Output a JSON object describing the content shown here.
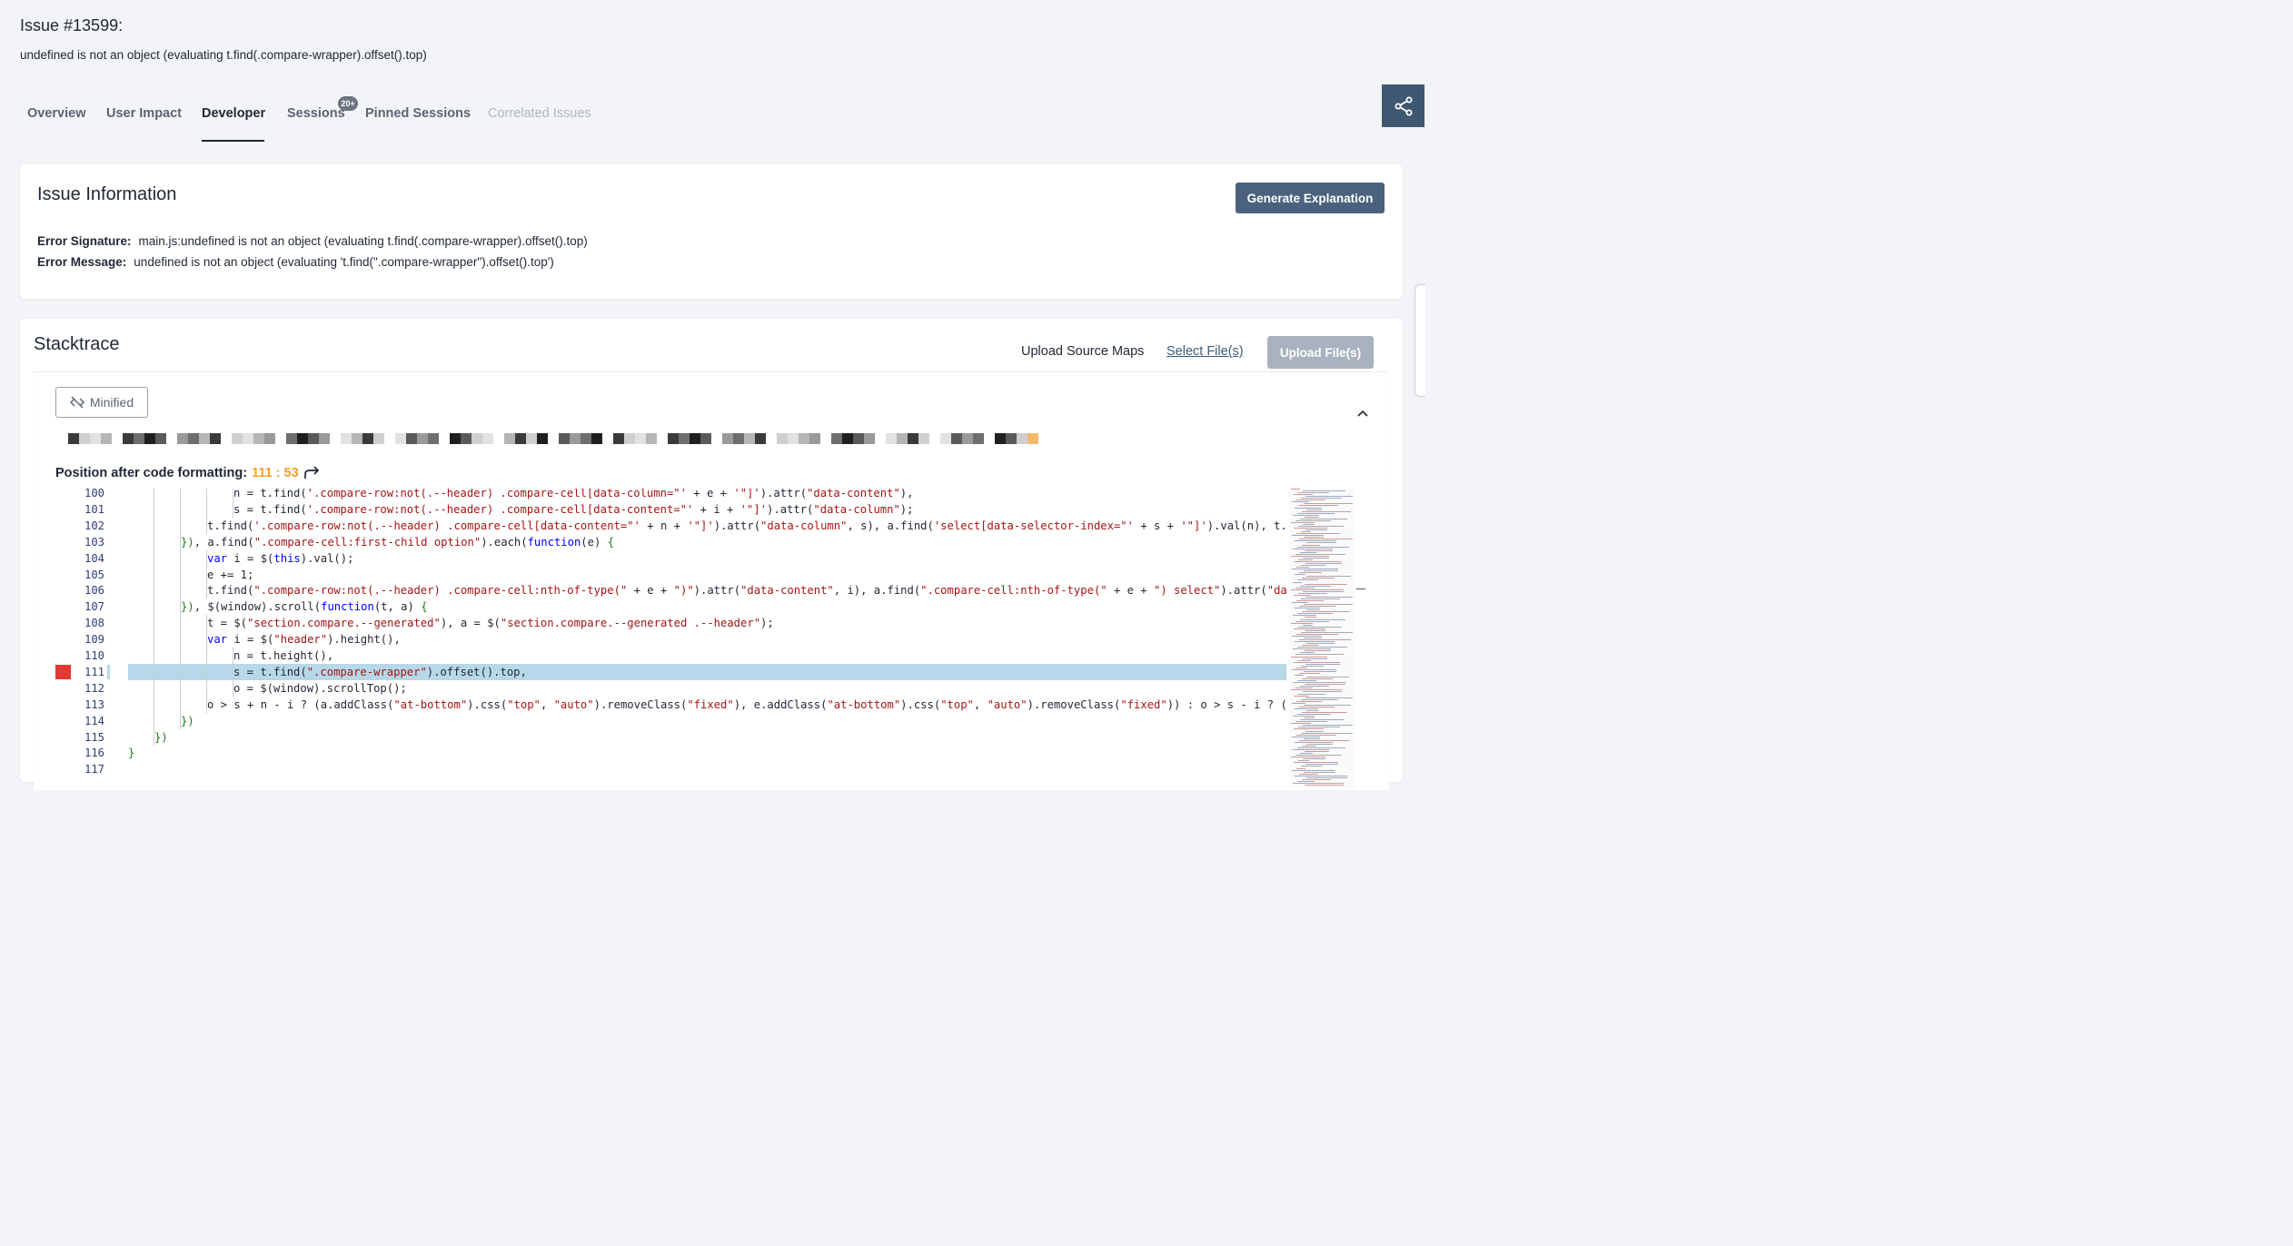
{
  "issue": {
    "title": "Issue #13599:",
    "subtitle": "undefined is not an object (evaluating t.find(.compare-wrapper).offset().top)"
  },
  "tabs": [
    {
      "label": "Overview",
      "state": "normal"
    },
    {
      "label": "User Impact",
      "state": "normal"
    },
    {
      "label": "Developer",
      "state": "active"
    },
    {
      "label": "Sessions",
      "state": "normal",
      "badge": "20+"
    },
    {
      "label": "Pinned Sessions",
      "state": "normal"
    },
    {
      "label": "Correlated Issues",
      "state": "disabled"
    }
  ],
  "issue_info": {
    "title": "Issue Information",
    "generate_label": "Generate Explanation",
    "signature_label": "Error Signature:",
    "signature_value": "main.js:undefined is not an object (evaluating t.find(.compare-wrapper).offset().top)",
    "message_label": "Error Message:",
    "message_value": "undefined is not an object (evaluating 't.find(\".compare-wrapper\").offset().top')"
  },
  "stacktrace": {
    "title": "Stacktrace",
    "upload_label": "Upload Source Maps",
    "select_files": "Select File(s)",
    "upload_files": "Upload File(s)",
    "minified_label": "Minified",
    "position_label": "Position after code formatting:",
    "position_value": "111 : 53"
  },
  "code": {
    "highlight_line": "111",
    "lines": [
      {
        "n": "100",
        "indent": 4
      },
      {
        "n": "101",
        "indent": 4
      },
      {
        "n": "102",
        "indent": 3
      },
      {
        "n": "103",
        "indent": 2
      },
      {
        "n": "104",
        "indent": 3
      },
      {
        "n": "105",
        "indent": 3
      },
      {
        "n": "106",
        "indent": 3
      },
      {
        "n": "107",
        "indent": 2
      },
      {
        "n": "108",
        "indent": 3
      },
      {
        "n": "109",
        "indent": 3
      },
      {
        "n": "110",
        "indent": 4
      },
      {
        "n": "111",
        "indent": 4
      },
      {
        "n": "112",
        "indent": 4
      },
      {
        "n": "113",
        "indent": 3
      },
      {
        "n": "114",
        "indent": 2
      },
      {
        "n": "115",
        "indent": 1
      },
      {
        "n": "116",
        "indent": 0
      },
      {
        "n": "117",
        "indent": 0
      }
    ]
  },
  "colors": {
    "accent": "#4a627d",
    "share": "#3f5872",
    "error_marker": "#e53935",
    "highlight": "#b7d8e8",
    "position_value": "#f5a02a"
  },
  "icons": [
    "share-icon",
    "hidden-code-icon",
    "chevron-up-icon",
    "redo-arrow-icon"
  ]
}
